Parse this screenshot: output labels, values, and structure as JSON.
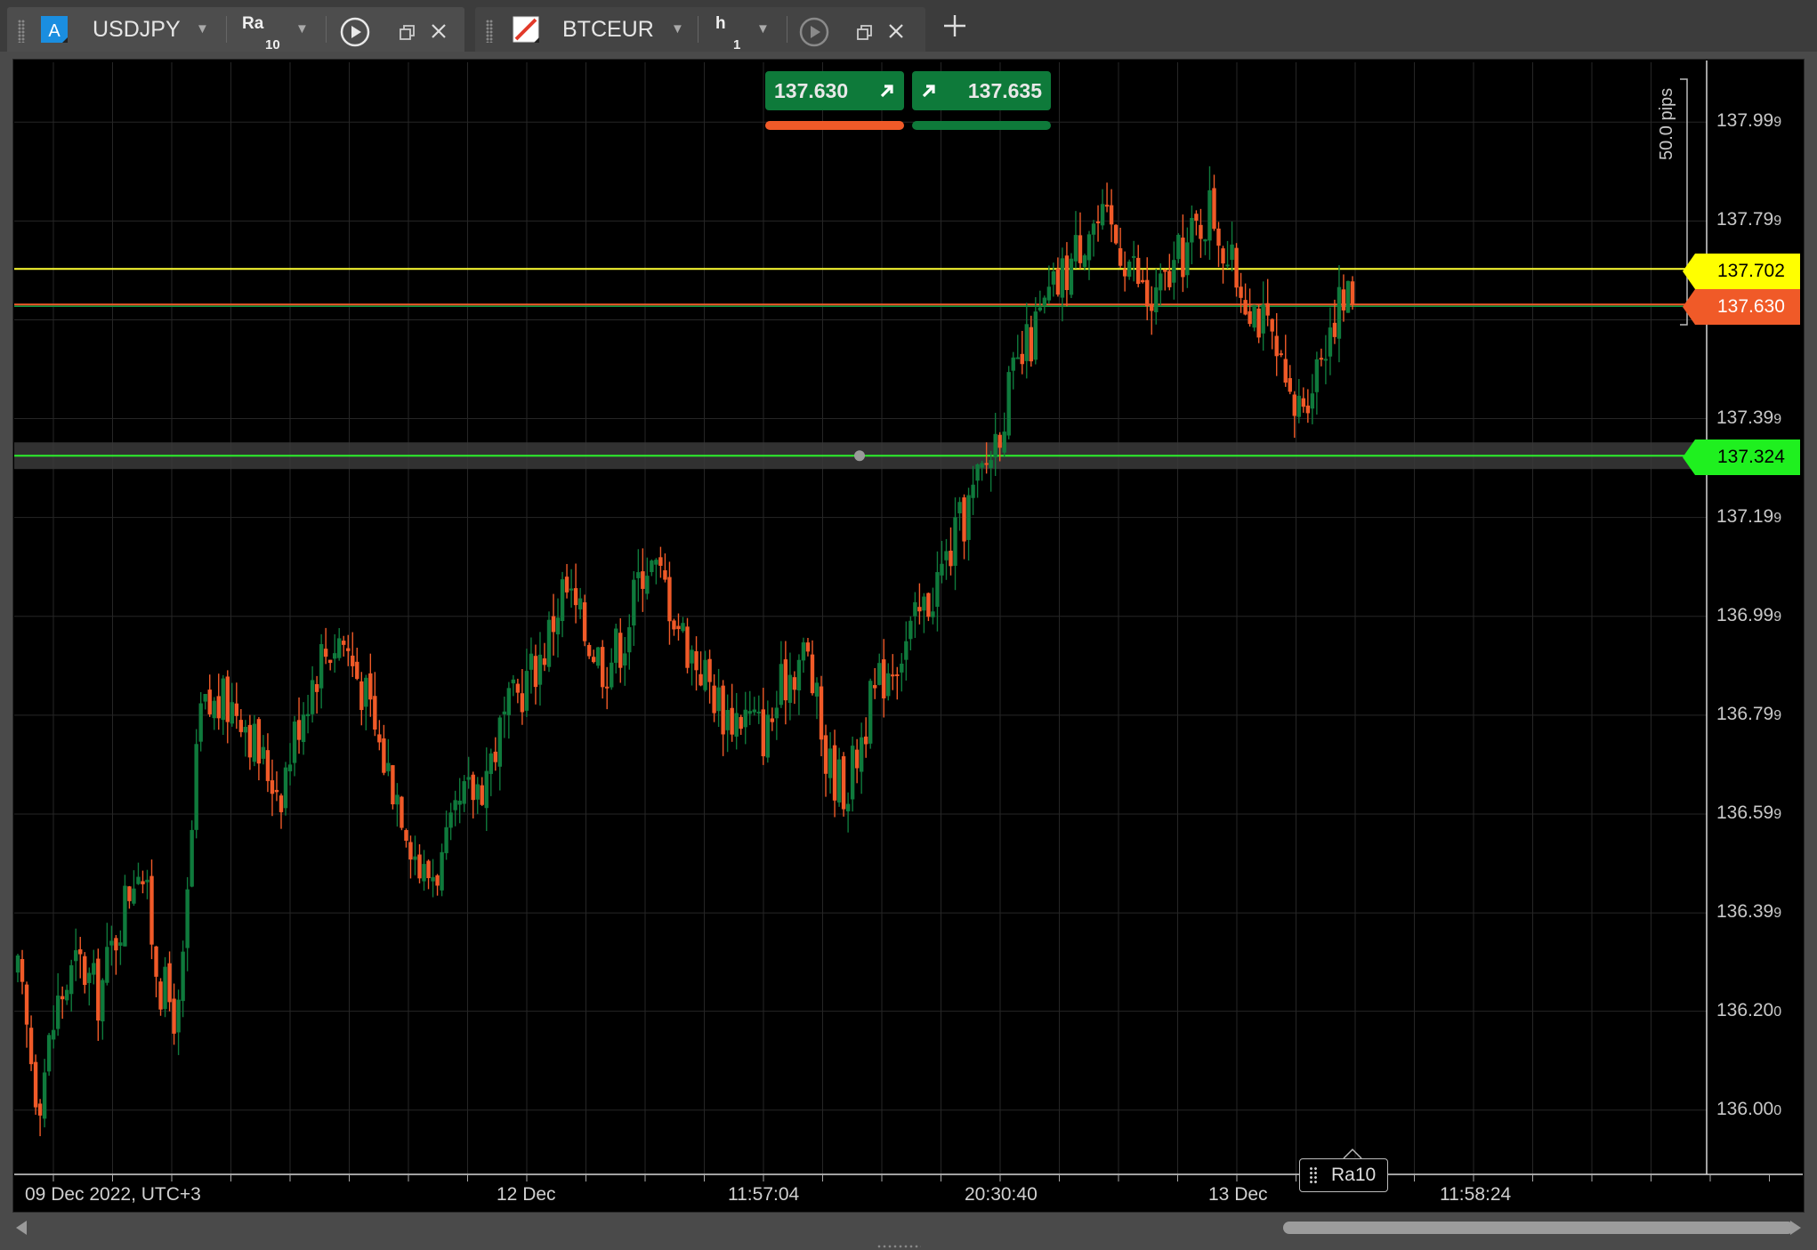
{
  "tabs": [
    {
      "symbol": "USDJPY",
      "timeframe_main": "Ra",
      "timeframe_sub": "10",
      "active": true
    },
    {
      "symbol": "BTCEUR",
      "timeframe_main": "h",
      "timeframe_sub": "1",
      "active": false
    }
  ],
  "quote": {
    "bid": "137.630",
    "ask": "137.635",
    "bid_color": "#f05a28",
    "ask_color": "#0e7a3a"
  },
  "price_axis": {
    "ticks": [
      "137.999",
      "137.799",
      "137.599",
      "137.399",
      "137.199",
      "136.999",
      "136.799",
      "136.599",
      "136.399",
      "136.200",
      "136.000"
    ]
  },
  "price_tags": [
    {
      "label": "137.702",
      "bg": "#ffff00",
      "fg": "#000000"
    },
    {
      "label": "137.630",
      "bg": "#f05a28",
      "fg": "#ffffff"
    },
    {
      "label": "137.324",
      "bg": "#1ff01f",
      "fg": "#000000"
    }
  ],
  "time_axis": {
    "labels": [
      "09 Dec 2022, UTC+3",
      "12 Dec",
      "11:57:04",
      "20:30:40",
      "13 Dec",
      "11:58:24"
    ]
  },
  "ruler": {
    "label": "50.0 pips"
  },
  "series_badge": "Ra10",
  "colors": {
    "up": "#0f7a3c",
    "down": "#f05a28",
    "background": "#000000",
    "grid": "#262626"
  },
  "chart_data": {
    "type": "candlestick",
    "ylim": [
      135.87,
      138.12
    ],
    "x": [
      "09 Dec 2022",
      "12 Dec",
      "11:57:04",
      "20:30:40",
      "13 Dec",
      "11:58:24"
    ],
    "horizontal_lines": [
      137.702,
      137.63,
      137.324
    ],
    "path_closes": [
      136.27,
      136.02,
      136.22,
      136.3,
      136.23,
      136.38,
      136.52,
      136.26,
      136.18,
      136.8,
      136.82,
      136.82,
      136.71,
      136.65,
      136.81,
      136.92,
      136.96,
      136.86,
      136.72,
      136.62,
      136.47,
      136.5,
      136.62,
      136.67,
      136.78,
      136.86,
      136.93,
      137.06,
      136.97,
      136.9,
      136.96,
      137.12,
      137.06,
      136.95,
      136.88,
      136.8,
      136.8,
      136.76,
      136.88,
      136.93,
      136.7,
      136.65,
      136.8,
      136.9,
      136.95,
      137.03,
      137.12,
      137.22,
      137.32,
      137.45,
      137.55,
      137.64,
      137.71,
      137.8,
      137.78,
      137.72,
      137.62,
      137.69,
      137.76,
      137.83,
      137.7,
      137.64,
      137.55,
      137.4,
      137.48,
      137.61,
      137.65
    ]
  }
}
